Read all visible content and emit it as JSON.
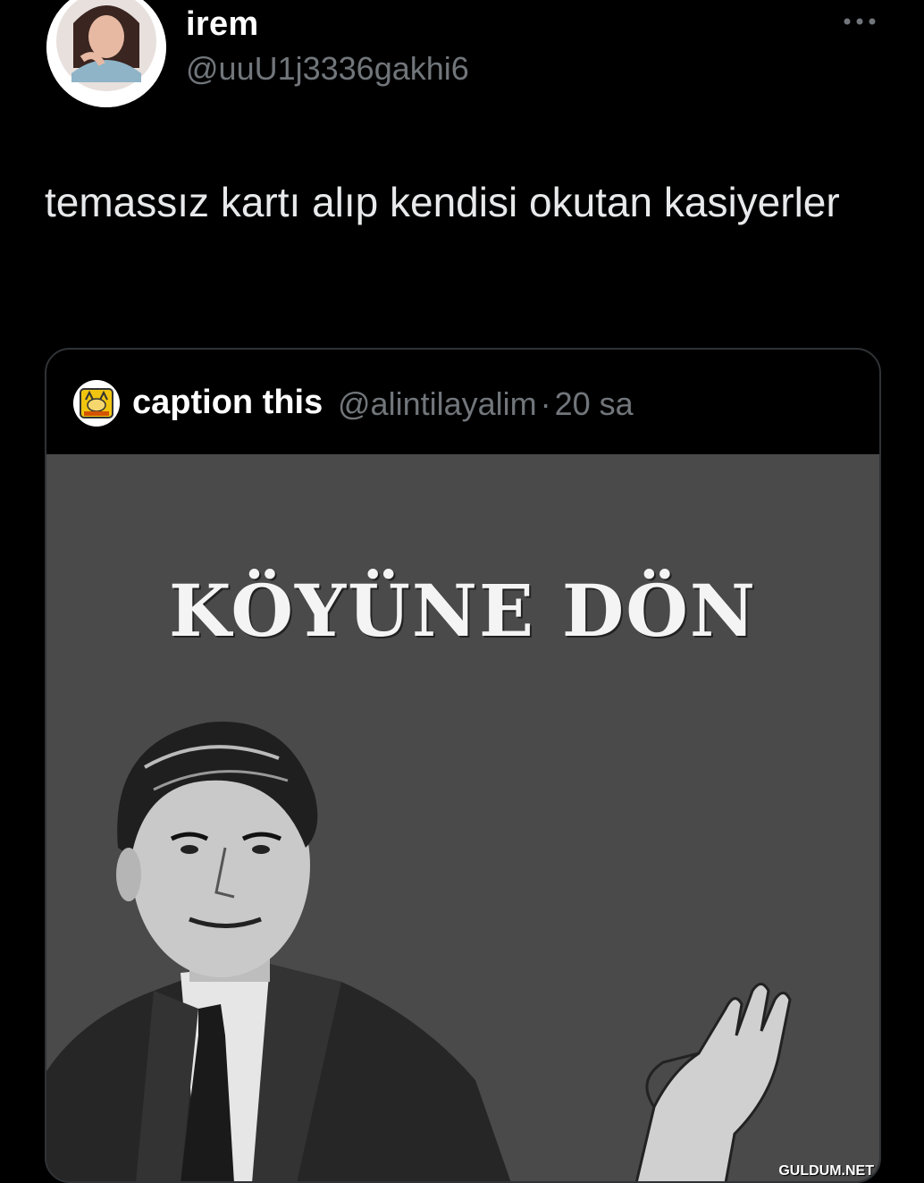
{
  "tweet": {
    "display_name": "irem",
    "handle": "@uuU1j3336gakhi6",
    "more_icon": "more-horizontal-icon",
    "text": "temassız kartı alıp kendisi okutan kasiyerler"
  },
  "quoted_tweet": {
    "display_name": "caption this",
    "handle": "@alintilayalim",
    "separator": "·",
    "time": "20 sa",
    "media": {
      "meme_title": "KÖYÜNE DÖN",
      "description_icon": "retro-man-hand-raised-illustration"
    }
  },
  "watermark": "GULDUM.NET",
  "colors": {
    "background": "#000000",
    "text_primary": "#e7e9ea",
    "text_secondary": "#71767b",
    "border": "#2f3336",
    "meme_background": "#4a4a4a"
  }
}
